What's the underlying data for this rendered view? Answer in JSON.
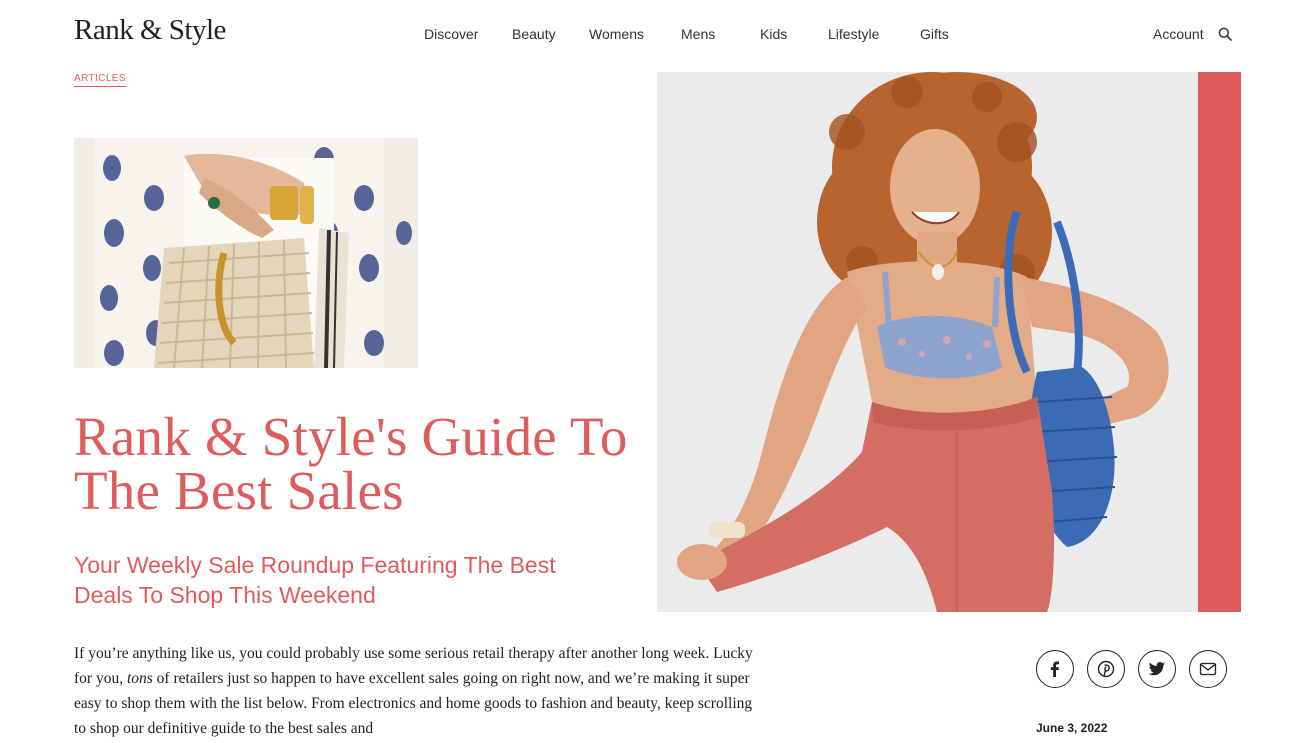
{
  "header": {
    "logo": "Rank & Style",
    "nav": [
      "Discover",
      "Beauty",
      "Womens",
      "Mens",
      "Kids",
      "Lifestyle",
      "Gifts"
    ],
    "account_label": "Account",
    "search_icon": "search-icon"
  },
  "article": {
    "category": "ARTICLES",
    "title": "Rank & Style's Guide To The Best Sales",
    "subtitle": "Your Weekly Sale Roundup Featuring The Best Deals To Shop This Weekend",
    "body_before": "If you’re anything like us, you could probably use some serious retail therapy after another long week. Lucky for you, ",
    "body_emphasis": "tons",
    "body_after": " of retailers just so happen to have excellent sales going on right now, and we’re making it super easy to shop them with the list below. From electronics and home goods to fashion and beauty, keep scrolling to shop our definitive guide to the best sales and",
    "date": "June 3, 2022"
  },
  "share": [
    "facebook-icon",
    "pinterest-icon",
    "twitter-icon",
    "email-icon"
  ],
  "colors": {
    "accent": "#df5c5c",
    "text": "#222222",
    "background": "#ffffff"
  }
}
